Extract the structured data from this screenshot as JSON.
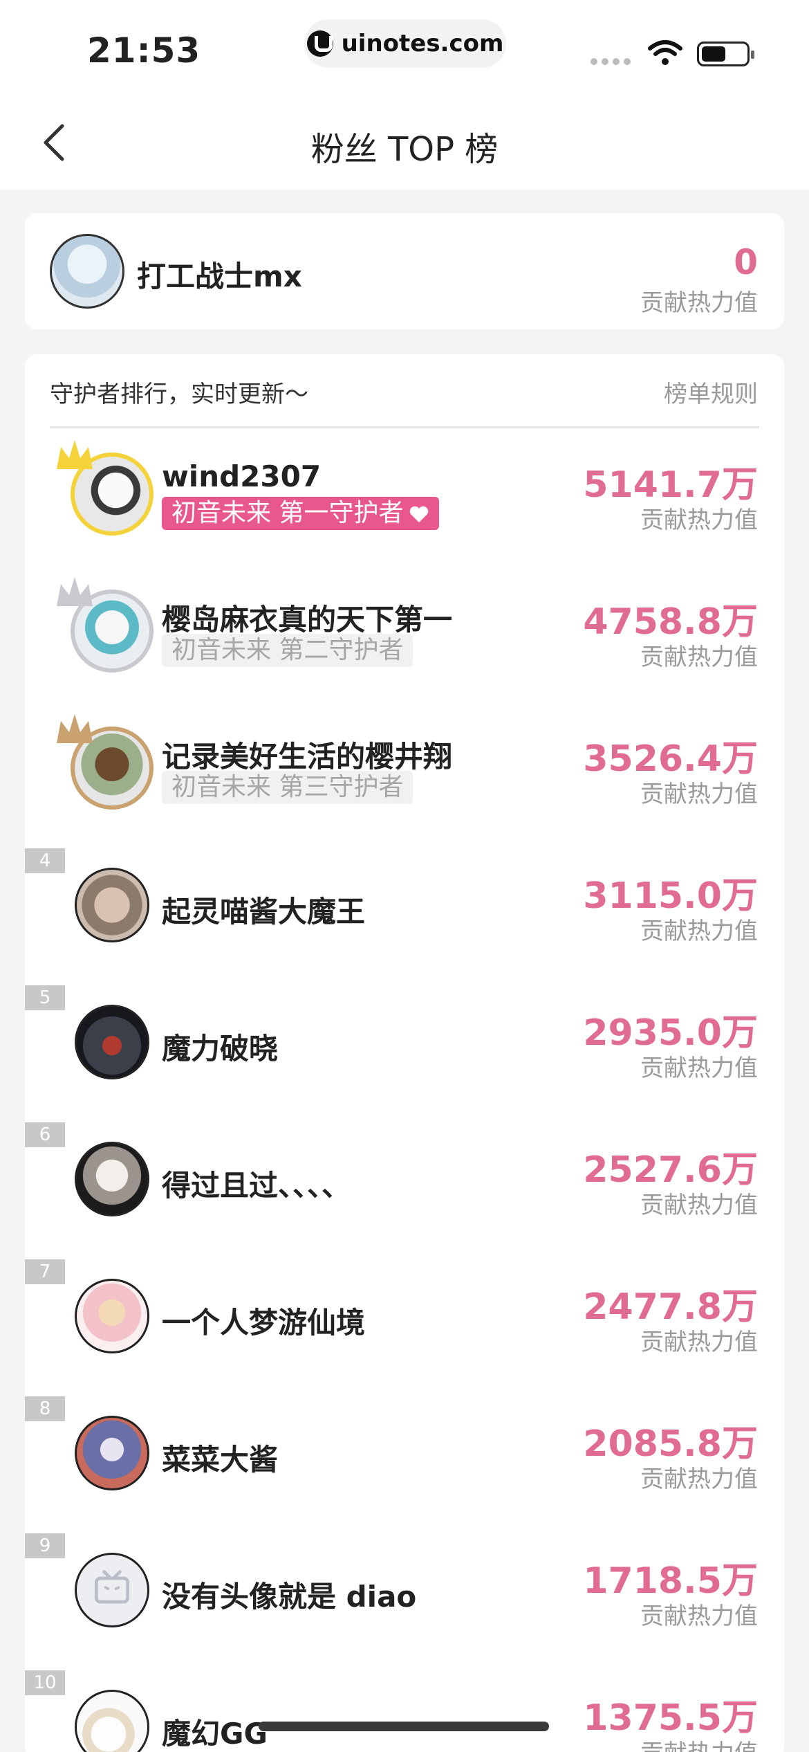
{
  "status_bar": {
    "time": "21:53",
    "url": "uinotes.com"
  },
  "nav": {
    "title": "粉丝 TOP 榜"
  },
  "my_card": {
    "name": "打工战士mx",
    "value": "0",
    "value_label": "贡献热力值"
  },
  "ranking": {
    "header": "守护者排行，实时更新～",
    "rules_label": "榜单规则",
    "items": [
      {
        "rank": "1",
        "name": "wind2307",
        "badge": "初音未来 第一守护者",
        "value": "5141.7万",
        "value_label": "贡献热力值"
      },
      {
        "rank": "2",
        "name": "樱岛麻衣真的天下第一",
        "badge": "初音未来 第二守护者",
        "value": "4758.8万",
        "value_label": "贡献热力值"
      },
      {
        "rank": "3",
        "name": "记录美好生活的樱井翔",
        "badge": "初音未来 第三守护者",
        "value": "3526.4万",
        "value_label": "贡献热力值"
      },
      {
        "rank": "4",
        "name": "起灵喵酱大魔王",
        "value": "3115.0万",
        "value_label": "贡献热力值"
      },
      {
        "rank": "5",
        "name": "魔力破晓",
        "value": "2935.0万",
        "value_label": "贡献热力值"
      },
      {
        "rank": "6",
        "name": "得过且过、、、、",
        "value": "2527.6万",
        "value_label": "贡献热力值"
      },
      {
        "rank": "7",
        "name": "一个人梦游仙境",
        "value": "2477.8万",
        "value_label": "贡献热力值"
      },
      {
        "rank": "8",
        "name": "菜菜大酱",
        "value": "2085.8万",
        "value_label": "贡献热力值"
      },
      {
        "rank": "9",
        "name": "没有头像就是 diao",
        "value": "1718.5万",
        "value_label": "贡献热力值"
      },
      {
        "rank": "10",
        "name": "魔幻GG",
        "value": "1375.5万",
        "value_label": "贡献热力值"
      }
    ]
  },
  "colors": {
    "accent_pink": "#e06c92",
    "badge_pink": "#e9588c",
    "gold": "#f4d33a",
    "silver": "#c9c9cf",
    "bronze": "#c9a270"
  }
}
